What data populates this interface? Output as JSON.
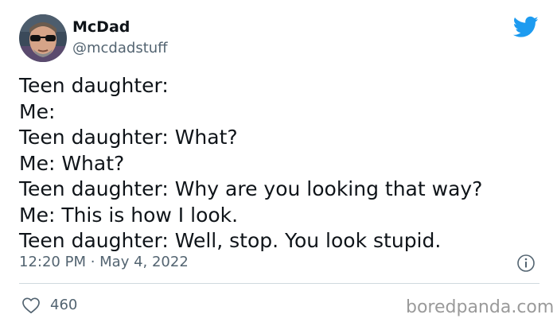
{
  "author": {
    "display_name": "McDad",
    "handle": "@mcdadstuff",
    "avatar": "avatar-photo"
  },
  "tweet": {
    "lines": [
      "Teen daughter:",
      "Me:",
      "Teen daughter: What?",
      "Me: What?",
      "Teen daughter: Why are you looking that way?",
      "Me: This is how I look.",
      "Teen daughter: Well, stop. You look stupid."
    ],
    "timestamp": "12:20 PM · May 4, 2022",
    "like_count": "460"
  },
  "icons": {
    "brand": "twitter-bird-icon",
    "info": "info-icon",
    "like": "heart-icon"
  },
  "colors": {
    "brand_blue": "#1d9bf0",
    "text_primary": "#0f1419",
    "text_secondary": "#536471",
    "divider": "#cfd9de"
  },
  "watermark": "boredpanda.com"
}
